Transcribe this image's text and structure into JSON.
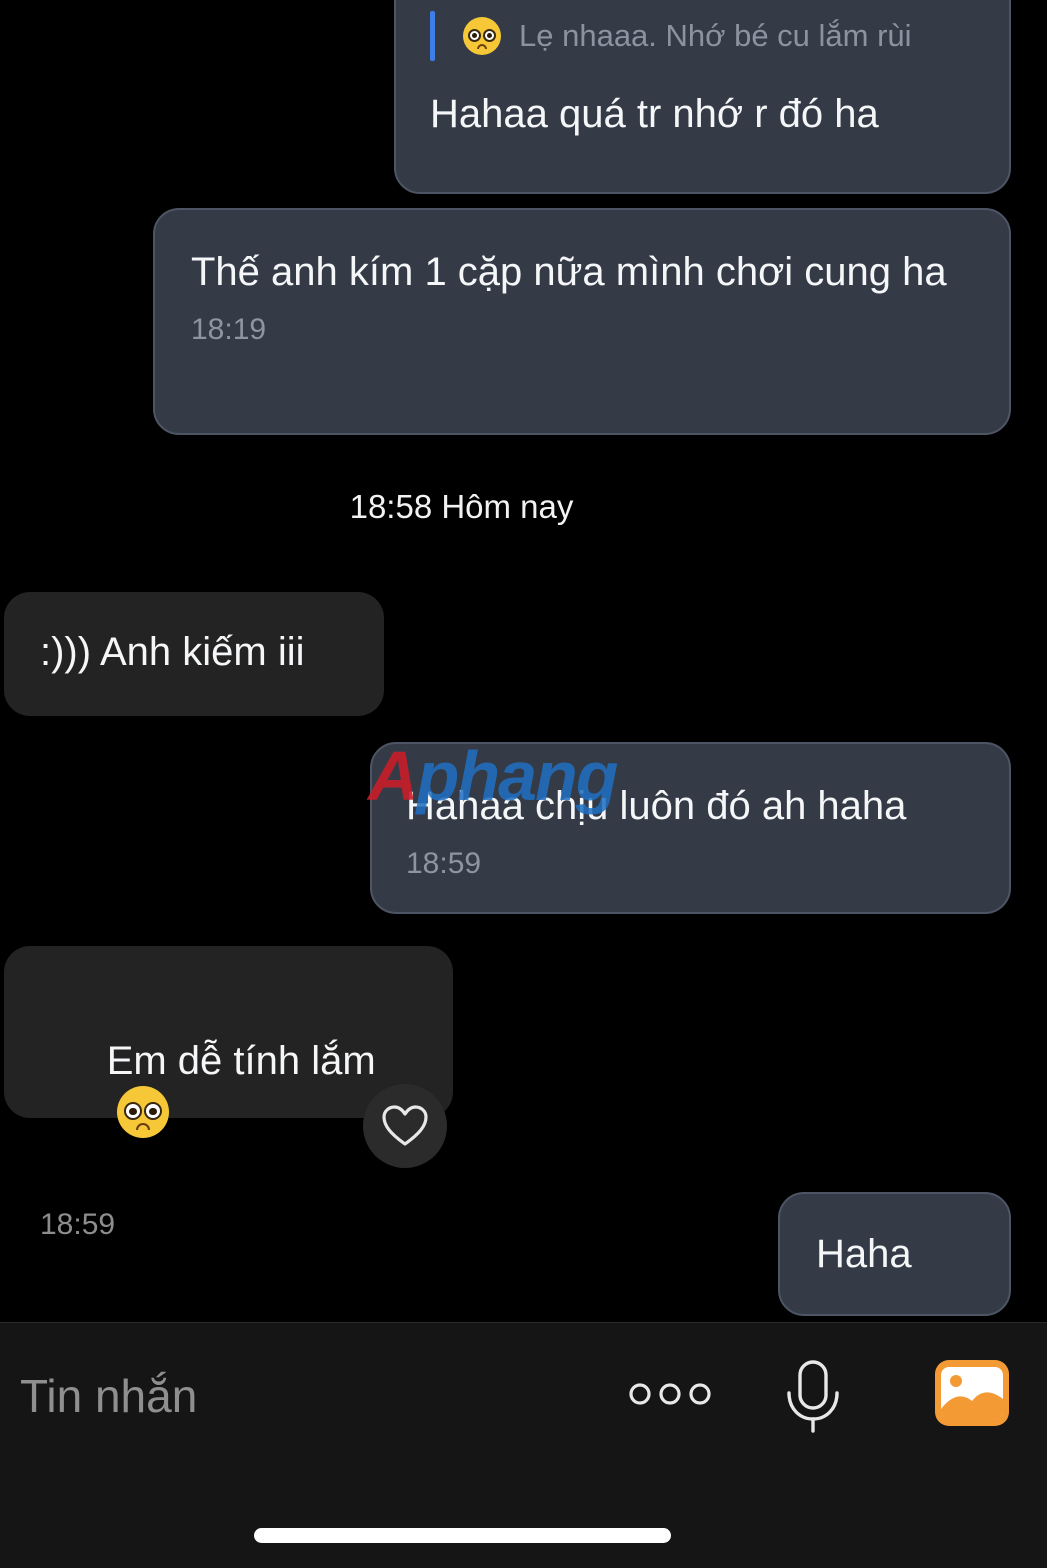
{
  "messages": [
    {
      "direction": "outgoing",
      "quote": "Lẹ nhaaa. Nhớ bé cu lắm rùi",
      "text": "Hahaa quá tr nhớ r đó ha"
    },
    {
      "direction": "outgoing",
      "text": "Thế anh kím 1 cặp nữa mình chơi cung ha",
      "time": "18:19"
    },
    {
      "direction": "incoming",
      "text": ":))) Anh kiếm iii"
    },
    {
      "direction": "outgoing",
      "text": "Hahaa chịu luôn đó ah haha",
      "time": "18:59"
    },
    {
      "direction": "incoming",
      "text": "Em dễ tính lắm",
      "time": "18:59"
    },
    {
      "direction": "outgoing",
      "text": "Haha"
    }
  ],
  "day_separator": "18:58 Hôm nay",
  "watermark": {
    "first": "A",
    "rest": "phang"
  },
  "composer": {
    "placeholder": "Tin nhắn"
  },
  "icons": {
    "quote_emoji": "pleading-face-emoji",
    "message_emoji": "pleading-face-emoji",
    "reaction": "heart-outline-icon",
    "more": "more-dots-icon",
    "mic": "microphone-icon",
    "image": "image-gallery-icon"
  },
  "colors": {
    "background": "#000000",
    "outgoing_bubble": "#343b47",
    "incoming_bubble": "#232323",
    "quote_bar": "#3d7ee8",
    "image_icon": "#f39a35",
    "composer_bg": "#151515"
  }
}
